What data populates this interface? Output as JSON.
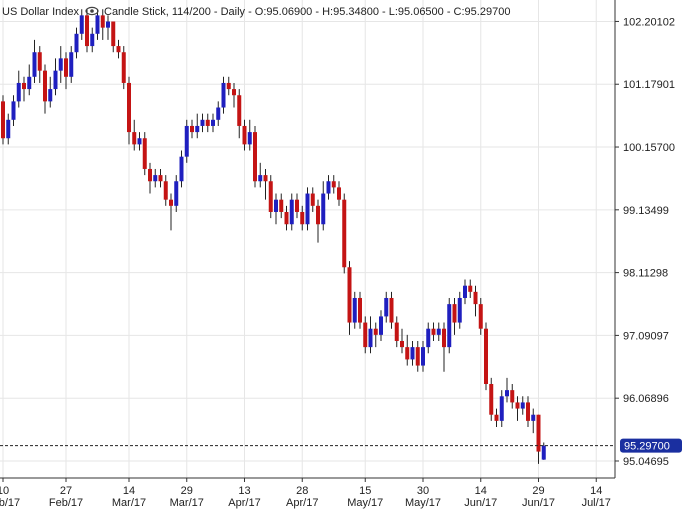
{
  "header": {
    "symbol": "US Dollar Index",
    "info": "Candle Stick, 114/200 - Daily - O:95.06900 - H:95.34800 - L:95.06500 - C:95.29700",
    "eye_icon": "eye-icon"
  },
  "colors": {
    "up": "#1f1fbf",
    "down": "#c41414",
    "grid": "#e6e6e6",
    "axis": "#333333",
    "last_badge": "#1a2fa0"
  },
  "chart_data": {
    "type": "candlestick",
    "title": "",
    "xlabel": "",
    "ylabel": "",
    "ylim": [
      94.77,
      102.55
    ],
    "y_ticks": [
      102.20102,
      101.17901,
      100.157,
      99.13499,
      98.11298,
      97.09097,
      96.06896,
      95.04695
    ],
    "y_tick_labels": [
      "102.20102",
      "101.17901",
      "100.15700",
      "99.13499",
      "98.11298",
      "97.09097",
      "96.06896",
      "95.04695"
    ],
    "x_ticks": [
      {
        "day": "10",
        "month": "Feb/17",
        "index": 0
      },
      {
        "day": "27",
        "month": "Feb/17",
        "index": 12
      },
      {
        "day": "14",
        "month": "Mar/17",
        "index": 24
      },
      {
        "day": "29",
        "month": "Mar/17",
        "index": 35
      },
      {
        "day": "13",
        "month": "Apr/17",
        "index": 46
      },
      {
        "day": "28",
        "month": "Apr/17",
        "index": 57
      },
      {
        "day": "15",
        "month": "May/17",
        "index": 69
      },
      {
        "day": "30",
        "month": "May/17",
        "index": 80
      },
      {
        "day": "14",
        "month": "Jun/17",
        "index": 91
      },
      {
        "day": "29",
        "month": "Jun/17",
        "index": 102
      },
      {
        "day": "14",
        "month": "Jul/17",
        "index": 113
      }
    ],
    "last_price": 95.297,
    "last_price_label": "95.29700",
    "grid": true,
    "candles": [
      [
        100.9,
        100.3,
        101.0,
        100.2
      ],
      [
        100.3,
        100.6,
        100.7,
        100.2
      ],
      [
        100.6,
        100.9,
        101.0,
        100.5
      ],
      [
        100.9,
        101.2,
        101.4,
        100.8
      ],
      [
        101.2,
        101.1,
        101.3,
        100.9
      ],
      [
        101.1,
        101.3,
        101.5,
        101.0
      ],
      [
        101.3,
        101.7,
        101.9,
        101.2
      ],
      [
        101.7,
        101.4,
        101.8,
        101.2
      ],
      [
        101.4,
        100.9,
        101.5,
        100.7
      ],
      [
        100.9,
        101.1,
        101.3,
        100.8
      ],
      [
        101.1,
        101.4,
        101.6,
        101.0
      ],
      [
        101.4,
        101.6,
        101.8,
        101.2
      ],
      [
        101.6,
        101.3,
        101.7,
        101.1
      ],
      [
        101.3,
        101.7,
        101.8,
        101.2
      ],
      [
        101.7,
        102.0,
        102.1,
        101.6
      ],
      [
        102.0,
        102.3,
        102.4,
        101.9
      ],
      [
        102.3,
        101.8,
        102.4,
        101.7
      ],
      [
        101.8,
        102.0,
        102.1,
        101.7
      ],
      [
        102.0,
        102.3,
        102.4,
        101.9
      ],
      [
        102.3,
        102.1,
        102.4,
        101.9
      ],
      [
        102.1,
        102.2,
        102.3,
        101.9
      ],
      [
        102.2,
        101.8,
        102.2,
        101.7
      ],
      [
        101.8,
        101.7,
        101.9,
        101.6
      ],
      [
        101.7,
        101.2,
        101.8,
        101.1
      ],
      [
        101.2,
        100.4,
        101.3,
        100.2
      ],
      [
        100.4,
        100.2,
        100.6,
        100.1
      ],
      [
        100.2,
        100.3,
        100.4,
        100.1
      ],
      [
        100.3,
        99.8,
        100.4,
        99.7
      ],
      [
        99.8,
        99.6,
        99.9,
        99.4
      ],
      [
        99.6,
        99.7,
        99.8,
        99.5
      ],
      [
        99.7,
        99.6,
        99.8,
        99.5
      ],
      [
        99.6,
        99.3,
        99.7,
        99.2
      ],
      [
        99.3,
        99.2,
        99.4,
        98.8
      ],
      [
        99.2,
        99.6,
        99.7,
        99.1
      ],
      [
        99.6,
        100.0,
        100.1,
        99.5
      ],
      [
        100.0,
        100.5,
        100.6,
        99.9
      ],
      [
        100.5,
        100.4,
        100.6,
        100.3
      ],
      [
        100.4,
        100.5,
        100.7,
        100.3
      ],
      [
        100.5,
        100.6,
        100.7,
        100.4
      ],
      [
        100.6,
        100.5,
        100.7,
        100.4
      ],
      [
        100.5,
        100.6,
        100.7,
        100.4
      ],
      [
        100.6,
        100.8,
        100.9,
        100.5
      ],
      [
        100.8,
        101.2,
        101.3,
        100.7
      ],
      [
        101.2,
        101.1,
        101.3,
        101.0
      ],
      [
        101.1,
        101.0,
        101.2,
        100.8
      ],
      [
        101.0,
        100.5,
        101.1,
        100.3
      ],
      [
        100.5,
        100.2,
        100.6,
        100.1
      ],
      [
        100.2,
        100.4,
        100.6,
        100.1
      ],
      [
        100.4,
        99.6,
        100.5,
        99.5
      ],
      [
        99.6,
        99.7,
        99.9,
        99.5
      ],
      [
        99.7,
        99.6,
        99.8,
        99.3
      ],
      [
        99.6,
        99.1,
        99.7,
        99.0
      ],
      [
        99.1,
        99.3,
        99.4,
        98.9
      ],
      [
        99.3,
        99.1,
        99.4,
        99.0
      ],
      [
        99.1,
        98.9,
        99.2,
        98.8
      ],
      [
        98.9,
        99.3,
        99.4,
        98.8
      ],
      [
        99.3,
        99.1,
        99.4,
        99.0
      ],
      [
        99.1,
        98.9,
        99.2,
        98.8
      ],
      [
        98.9,
        99.4,
        99.5,
        98.8
      ],
      [
        99.4,
        99.2,
        99.5,
        99.1
      ],
      [
        99.2,
        98.9,
        99.3,
        98.6
      ],
      [
        98.9,
        99.4,
        99.6,
        98.8
      ],
      [
        99.4,
        99.6,
        99.7,
        99.3
      ],
      [
        99.6,
        99.5,
        99.7,
        99.4
      ],
      [
        99.5,
        99.3,
        99.6,
        99.2
      ],
      [
        99.3,
        98.2,
        99.4,
        98.1
      ],
      [
        98.2,
        97.3,
        98.3,
        97.1
      ],
      [
        97.3,
        97.7,
        97.8,
        97.2
      ],
      [
        97.7,
        97.3,
        97.8,
        97.2
      ],
      [
        97.3,
        96.9,
        97.4,
        96.8
      ],
      [
        96.9,
        97.2,
        97.4,
        96.8
      ],
      [
        97.2,
        97.1,
        97.3,
        96.9
      ],
      [
        97.1,
        97.4,
        97.5,
        97.0
      ],
      [
        97.4,
        97.7,
        97.8,
        97.3
      ],
      [
        97.7,
        97.3,
        97.8,
        97.2
      ],
      [
        97.3,
        97.0,
        97.4,
        96.9
      ],
      [
        97.0,
        96.9,
        97.2,
        96.8
      ],
      [
        96.9,
        96.7,
        97.1,
        96.6
      ],
      [
        96.7,
        96.9,
        97.0,
        96.6
      ],
      [
        96.9,
        96.6,
        97.0,
        96.5
      ],
      [
        96.6,
        96.9,
        97.0,
        96.5
      ],
      [
        96.9,
        97.2,
        97.3,
        96.8
      ],
      [
        97.2,
        97.1,
        97.3,
        97.0
      ],
      [
        97.1,
        97.2,
        97.3,
        97.0
      ],
      [
        97.2,
        96.9,
        97.3,
        96.5
      ],
      [
        96.9,
        97.6,
        97.7,
        96.8
      ],
      [
        97.6,
        97.3,
        97.7,
        97.1
      ],
      [
        97.3,
        97.7,
        97.8,
        97.2
      ],
      [
        97.7,
        97.9,
        98.0,
        97.6
      ],
      [
        97.9,
        97.8,
        98.0,
        97.7
      ],
      [
        97.8,
        97.6,
        97.9,
        97.4
      ],
      [
        97.6,
        97.2,
        97.7,
        97.1
      ],
      [
        97.2,
        96.3,
        97.3,
        96.2
      ],
      [
        96.3,
        95.8,
        96.4,
        95.7
      ],
      [
        95.8,
        95.7,
        95.9,
        95.6
      ],
      [
        95.7,
        96.1,
        96.2,
        95.6
      ],
      [
        96.1,
        96.2,
        96.4,
        96.0
      ],
      [
        96.2,
        96.0,
        96.3,
        95.9
      ],
      [
        96.0,
        95.9,
        96.1,
        95.7
      ],
      [
        95.9,
        96.0,
        96.1,
        95.8
      ],
      [
        96.0,
        95.7,
        96.1,
        95.6
      ],
      [
        95.7,
        95.8,
        95.9,
        95.5
      ],
      [
        95.8,
        95.2,
        95.8,
        95.0
      ],
      [
        95.069,
        95.297,
        95.348,
        95.065
      ]
    ]
  }
}
